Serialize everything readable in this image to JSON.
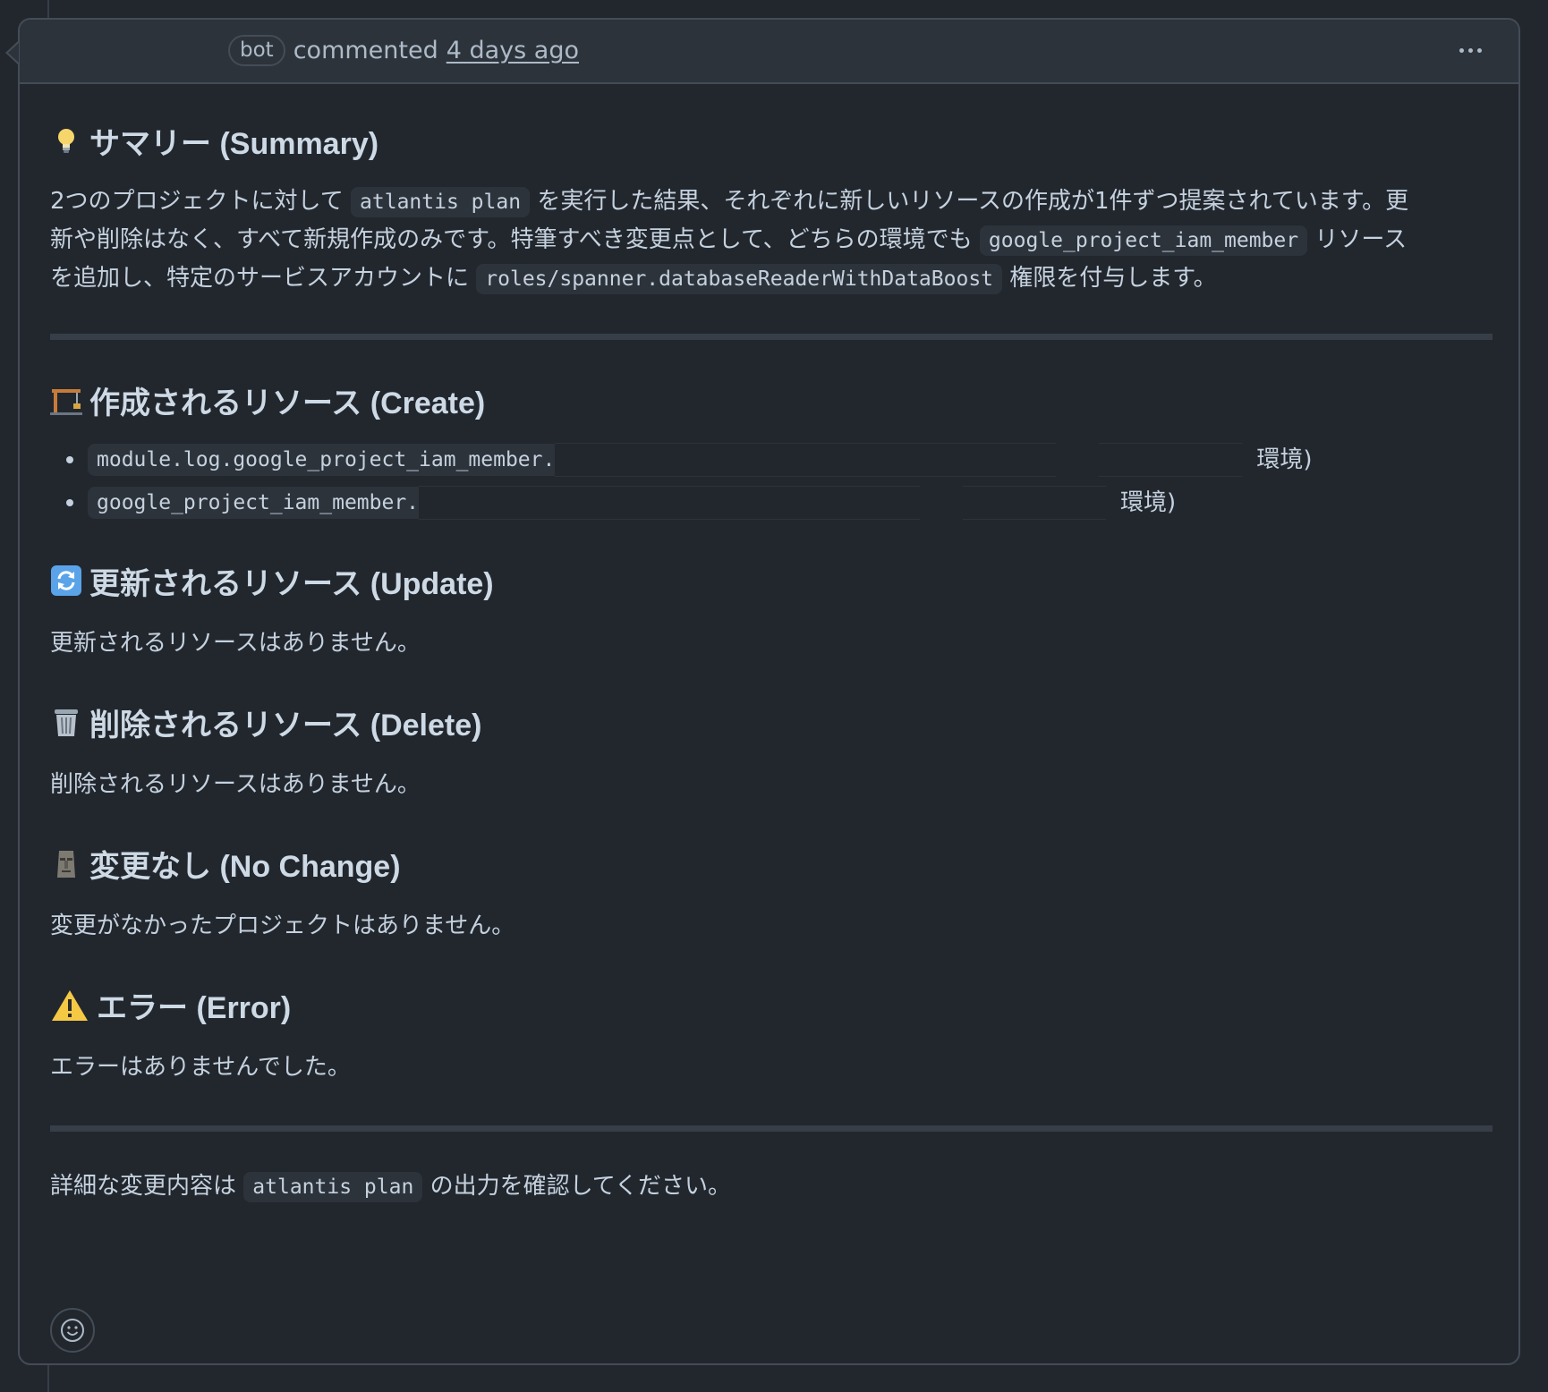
{
  "header": {
    "badge": "bot",
    "action": "commented",
    "time": "4 days ago"
  },
  "summary": {
    "heading": "サマリー (Summary)",
    "icon": "lightbulb-icon",
    "p1_a": "2つのプロジェクトに対して",
    "p1_code1": "atlantis plan",
    "p1_b": "を実行した結果、それぞれに新しいリソースの作成が1件ずつ提案されています。更",
    "p2_a": "新や削除はなく、すべて新規作成のみです。特筆すべき変更点として、どちらの環境でも",
    "p2_code": "google_project_iam_member",
    "p2_b": "リソース",
    "p3_a": "を追加し、特定のサービスアカウントに",
    "p3_code": "roles/spanner.databaseReaderWithDataBoost",
    "p3_b": "権限を付与します。"
  },
  "create": {
    "heading": "作成されるリソース (Create)",
    "icon": "construction-crane-icon",
    "items": [
      {
        "code": "module.log.google_project_iam_member.",
        "suffix": "環境)"
      },
      {
        "code": "google_project_iam_member.",
        "suffix": "環境)"
      }
    ]
  },
  "update": {
    "heading": "更新されるリソース (Update)",
    "icon": "arrows-cycle-icon",
    "text": "更新されるリソースはありません。"
  },
  "delete": {
    "heading": "削除されるリソース (Delete)",
    "icon": "trash-can-icon",
    "text": "削除されるリソースはありません。"
  },
  "nochange": {
    "heading": "変更なし (No Change)",
    "icon": "moai-icon",
    "text": "変更がなかったプロジェクトはありません。"
  },
  "error": {
    "heading": "エラー (Error)",
    "icon": "warning-icon",
    "text": "エラーはありませんでした。"
  },
  "footer": {
    "text_a": "詳細な変更内容は",
    "code": "atlantis plan",
    "text_b": "の出力を確認してください。"
  },
  "colors": {
    "background": "#22272e",
    "header_bg": "#2d333b",
    "border": "#444c56",
    "text": "#c5d1de"
  }
}
